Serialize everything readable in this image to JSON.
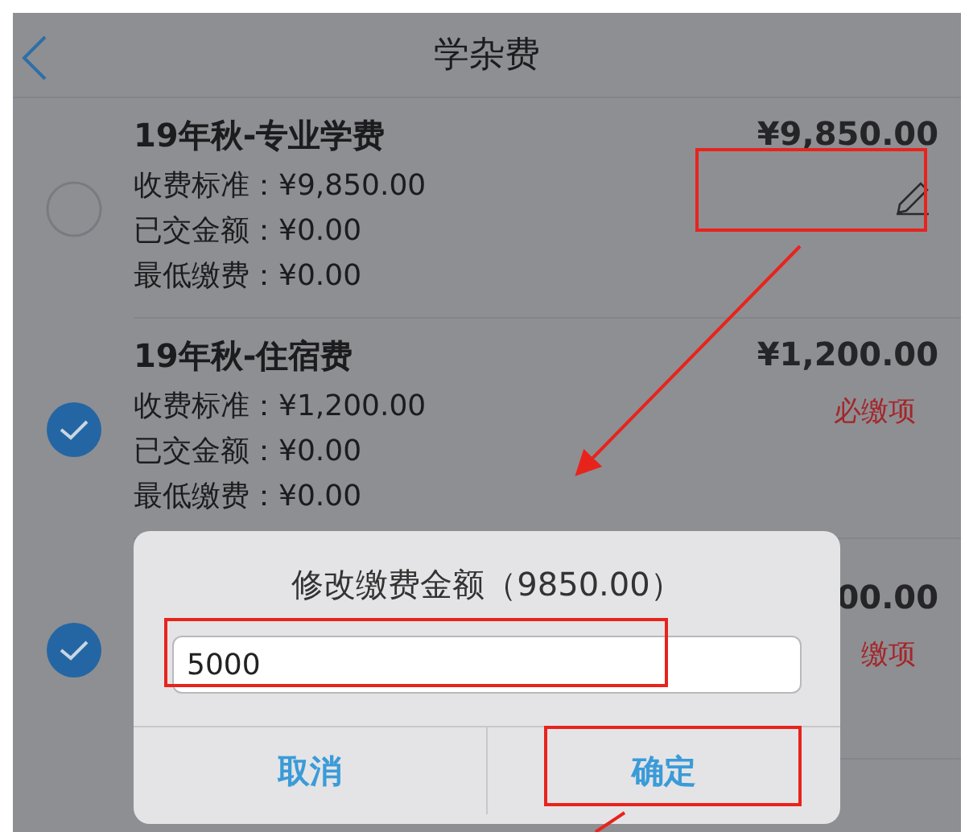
{
  "nav": {
    "title": "学杂费"
  },
  "fees": [
    {
      "name": "19年秋-专业学费",
      "amount": "¥9,850.00",
      "checked": false,
      "editable": true,
      "details": [
        "收费标准：¥9,850.00",
        "已交金额：¥0.00",
        "最低缴费：¥0.00"
      ]
    },
    {
      "name": "19年秋-住宿费",
      "amount": "¥1,200.00",
      "checked": true,
      "editable": false,
      "tag": "必缴项",
      "details": [
        "收费标准：¥1,200.00",
        "已交金额：¥0.00",
        "最低缴费：¥0.00"
      ]
    },
    {
      "amount": "00.00",
      "checked": true,
      "editable": false,
      "tag": "缴项"
    }
  ],
  "dialog": {
    "title": "修改缴费金额（9850.00）",
    "value": "5000",
    "buttons": [
      {
        "label": "取消"
      },
      {
        "label": "确定"
      }
    ]
  }
}
